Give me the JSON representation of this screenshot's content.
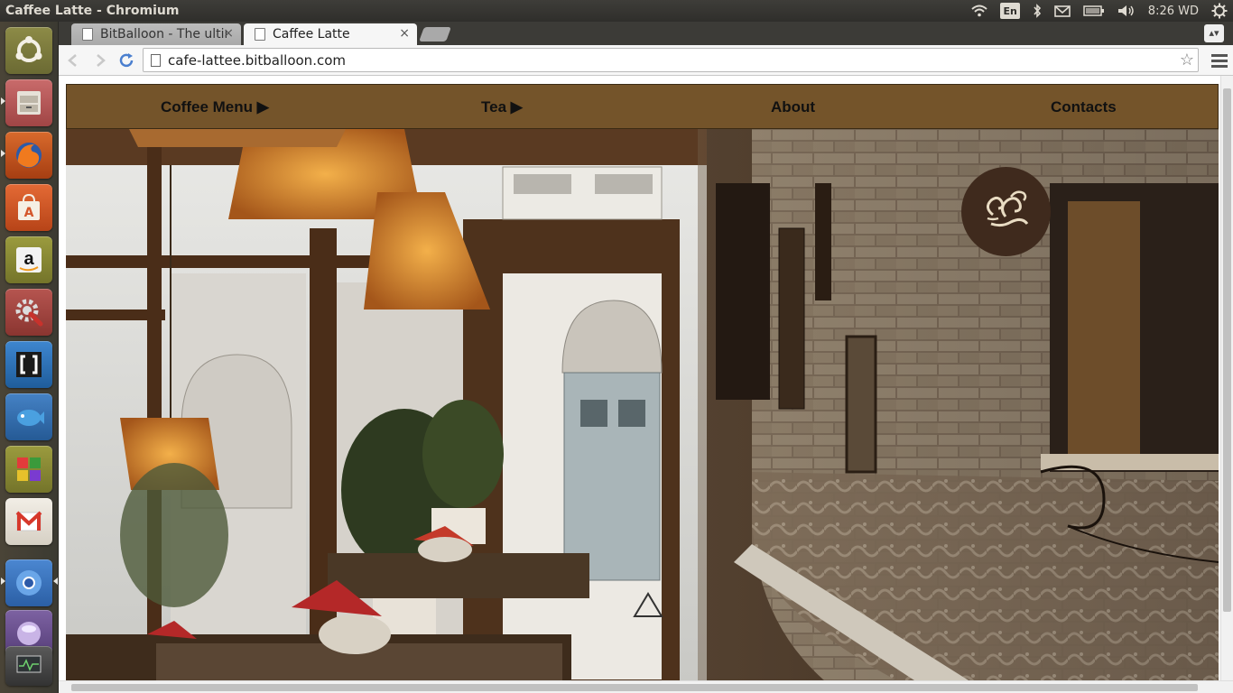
{
  "window": {
    "title": "Caffee Latte - Chromium"
  },
  "top_panel": {
    "indicators": [
      {
        "icon": "wifi-icon"
      },
      {
        "icon": "keyboard-layout-icon",
        "label": "En"
      },
      {
        "icon": "bluetooth-icon"
      },
      {
        "icon": "mail-icon"
      },
      {
        "icon": "battery-icon"
      },
      {
        "icon": "volume-icon"
      }
    ],
    "clock": "8:26 WD",
    "session_icon": "gear-icon"
  },
  "launcher": {
    "items": [
      {
        "name": "ubuntu-dash",
        "icon": "ubuntu-logo-icon",
        "color": "#7b7a3c"
      },
      {
        "name": "files",
        "icon": "file-cabinet-icon",
        "color": "#b85858"
      },
      {
        "name": "firefox",
        "icon": "firefox-icon",
        "color": "#c04a1d"
      },
      {
        "name": "software-center",
        "icon": "shopping-bag-icon",
        "color": "#d4562a"
      },
      {
        "name": "amazon",
        "icon": "amazon-icon",
        "color": "#8a8a2e"
      },
      {
        "name": "system-settings",
        "icon": "wrench-gear-icon",
        "color": "#a0403a"
      },
      {
        "name": "brackets",
        "icon": "brackets-icon",
        "color": "#2a6fb5"
      },
      {
        "name": "bluefish",
        "icon": "fish-icon",
        "color": "#2f6aa8"
      },
      {
        "name": "colored-squares-app",
        "icon": "four-squares-icon",
        "color": "#8a8a2e"
      },
      {
        "name": "gmail",
        "icon": "gmail-icon",
        "color": "#e8e2d6"
      },
      {
        "name": "chromium",
        "icon": "chromium-icon",
        "color": "#3a6fb8"
      },
      {
        "name": "workspace-switcher",
        "icon": "orb-icon",
        "color": "#6a4f8c"
      },
      {
        "name": "system-monitor",
        "icon": "monitor-icon",
        "color": "#4a4a4a"
      }
    ]
  },
  "browser": {
    "tabs": [
      {
        "title": "BitBalloon - The ultimate hosting for modern websites",
        "active": false
      },
      {
        "title": "Caffee Latte",
        "active": true
      }
    ],
    "close_glyph": "×",
    "url": "cafe-lattee.bitballoon.com"
  },
  "site": {
    "nav": [
      {
        "label": "Coffee Menu ▶"
      },
      {
        "label": "Tea ▶"
      },
      {
        "label": "About"
      },
      {
        "label": "Contacts"
      }
    ],
    "colors": {
      "nav_bg": "#74542a",
      "logo_bg": "#3f2a1d",
      "logo_fg": "#e9dcc3"
    }
  }
}
